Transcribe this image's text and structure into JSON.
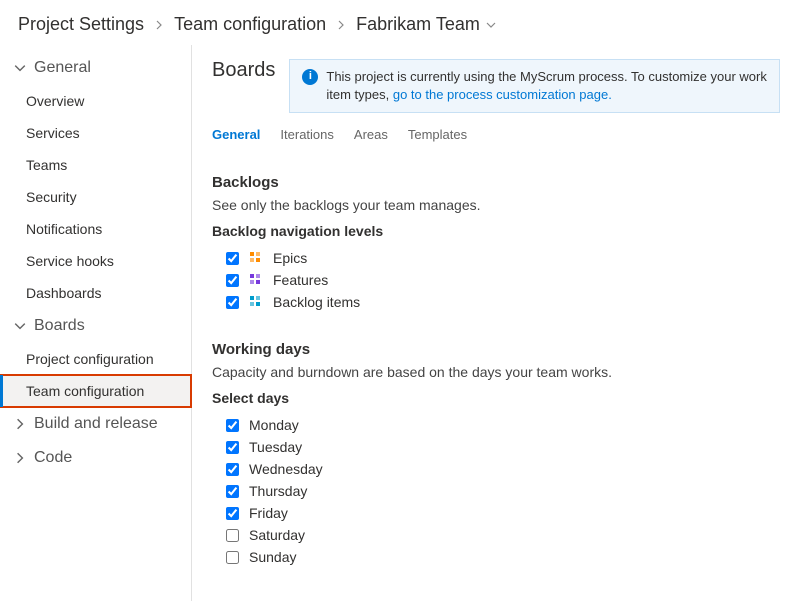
{
  "breadcrumb": {
    "root": "Project Settings",
    "mid": "Team configuration",
    "leaf": "Fabrikam Team"
  },
  "sidebar": {
    "groups": [
      {
        "label": "General",
        "expanded": true,
        "items": [
          {
            "label": "Overview"
          },
          {
            "label": "Services"
          },
          {
            "label": "Teams"
          },
          {
            "label": "Security"
          },
          {
            "label": "Notifications"
          },
          {
            "label": "Service hooks"
          },
          {
            "label": "Dashboards"
          }
        ]
      },
      {
        "label": "Boards",
        "expanded": true,
        "items": [
          {
            "label": "Project configuration"
          },
          {
            "label": "Team configuration",
            "active": true,
            "highlighted": true
          }
        ]
      },
      {
        "label": "Build and release",
        "expanded": false,
        "items": []
      },
      {
        "label": "Code",
        "expanded": false,
        "items": []
      }
    ]
  },
  "page": {
    "title": "Boards",
    "banner_text": "This project is currently using the MyScrum process. To customize your work item types, ",
    "banner_link": "go to the process customization page."
  },
  "tabs": [
    {
      "label": "General",
      "active": true
    },
    {
      "label": "Iterations"
    },
    {
      "label": "Areas"
    },
    {
      "label": "Templates"
    }
  ],
  "backlogs": {
    "heading": "Backlogs",
    "desc": "See only the backlogs your team manages.",
    "subhead": "Backlog navigation levels",
    "levels": [
      {
        "label": "Epics",
        "checked": true,
        "icon_color": "#ff8c00"
      },
      {
        "label": "Features",
        "checked": true,
        "icon_color": "#773adc"
      },
      {
        "label": "Backlog items",
        "checked": true,
        "icon_color": "#009ccc"
      }
    ]
  },
  "working_days": {
    "heading": "Working days",
    "desc": "Capacity and burndown are based on the days your team works.",
    "subhead": "Select days",
    "days": [
      {
        "label": "Monday",
        "checked": true
      },
      {
        "label": "Tuesday",
        "checked": true
      },
      {
        "label": "Wednesday",
        "checked": true
      },
      {
        "label": "Thursday",
        "checked": true
      },
      {
        "label": "Friday",
        "checked": true
      },
      {
        "label": "Saturday",
        "checked": false
      },
      {
        "label": "Sunday",
        "checked": false
      }
    ]
  }
}
